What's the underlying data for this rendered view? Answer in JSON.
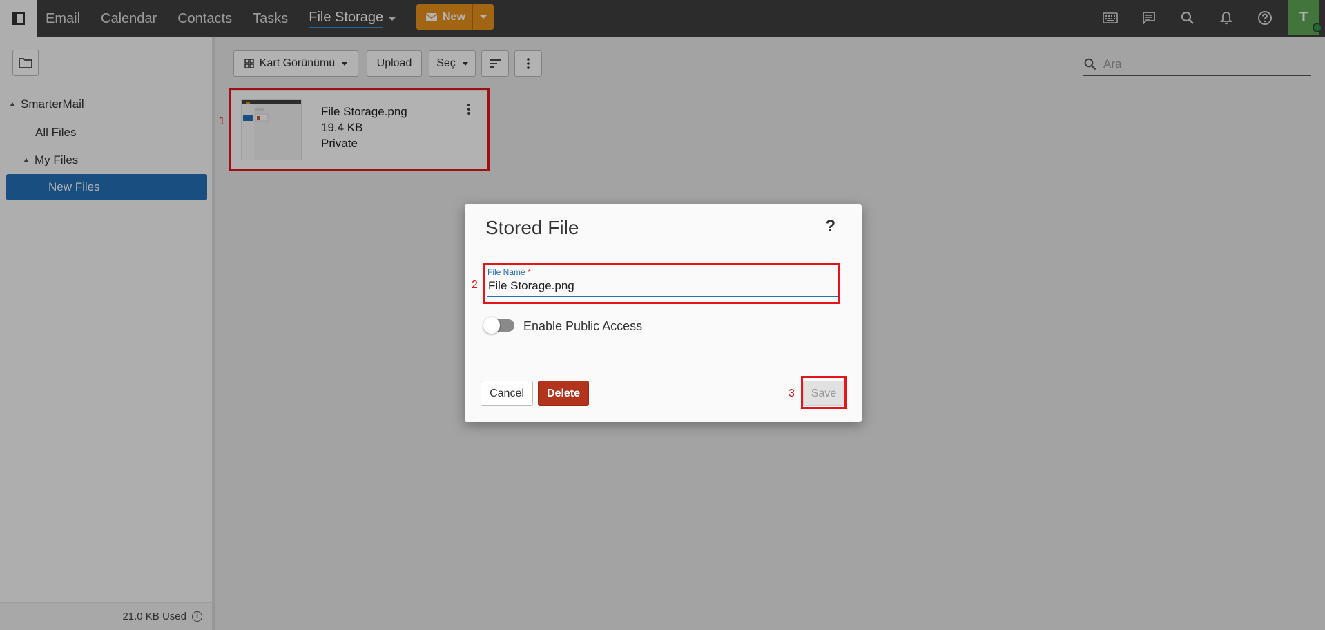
{
  "topbar": {
    "nav": [
      "Email",
      "Calendar",
      "Contacts",
      "Tasks"
    ],
    "active_nav": "File Storage",
    "new_button": "New",
    "avatar_initial": "T",
    "icons": [
      "sidebar-toggle-icon",
      "keyboard-icon",
      "chat-icon",
      "search-icon",
      "bell-icon",
      "help-icon"
    ]
  },
  "sidebar": {
    "root": "SmarterMail",
    "all_files": "All Files",
    "my_files": "My Files",
    "selected": "New Files",
    "usage": "21.0 KB Used"
  },
  "toolbar": {
    "view": "Kart Görünümü",
    "upload": "Upload",
    "select": "Seç",
    "search_placeholder": "Ara"
  },
  "file_card": {
    "name": "File Storage.png",
    "size": "19.4 KB",
    "access": "Private"
  },
  "steps": [
    "1",
    "2",
    "3"
  ],
  "modal": {
    "title": "Stored File",
    "help": "?",
    "field_label": "File Name",
    "required_mark": "*",
    "field_value": "File Storage.png",
    "toggle_label": "Enable Public Access",
    "toggle_on": false,
    "cancel": "Cancel",
    "delete": "Delete",
    "save": "Save"
  },
  "colors": {
    "topbar": "#3f3f3f",
    "accent": "#2371b8",
    "new_button": "#e8911c",
    "delete_button": "#b2341c",
    "highlight": "#e5141b",
    "avatar": "#5fa857"
  }
}
